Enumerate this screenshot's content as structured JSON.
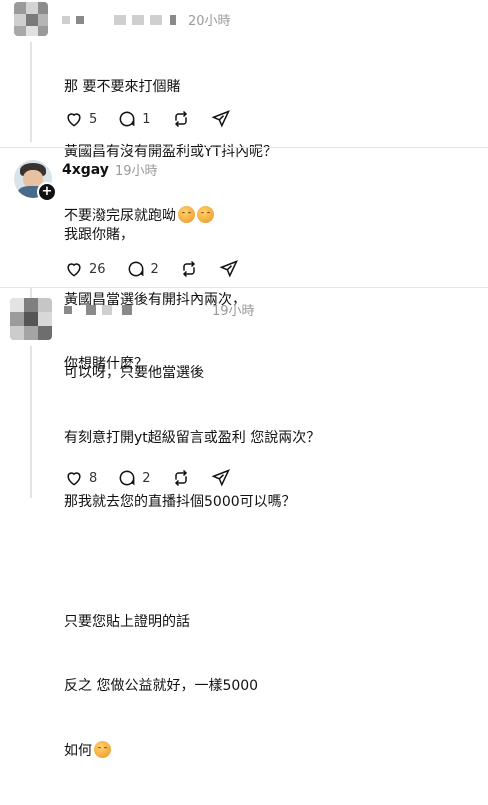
{
  "posts": [
    {
      "handle": "",
      "time": "20小時",
      "lines": [
        "那 要不要來打個賭",
        "黃國昌有沒有開盈利或YT抖內呢？",
        "不要潑完尿就跑呦"
      ],
      "actions": {
        "likes": "5",
        "replies": "1",
        "reposts": "",
        "shares": ""
      },
      "emoji": "drooling-face-icon"
    },
    {
      "handle": "4xgay",
      "time": "19小時",
      "lines": [
        "我跟你賭，",
        "黃國昌當選後有開抖內兩次，",
        "你想賭什麼？"
      ],
      "actions": {
        "likes": "26",
        "replies": "2",
        "reposts": "",
        "shares": ""
      },
      "follow_symbol": "+"
    },
    {
      "handle": "",
      "time": "19小時",
      "lines": [
        "可以呀，只要他當選後",
        "有刻意打開yt超級留言或盈利 您說兩次？",
        "那我就去您的直播抖個5000可以嗎？",
        "",
        "只要您貼上證明的話",
        "反之 您做公益就好，一樣5000",
        "如何"
      ],
      "actions": {
        "likes": "8",
        "replies": "2",
        "reposts": "",
        "shares": ""
      },
      "emoji": "drooling-face-icon"
    }
  ]
}
